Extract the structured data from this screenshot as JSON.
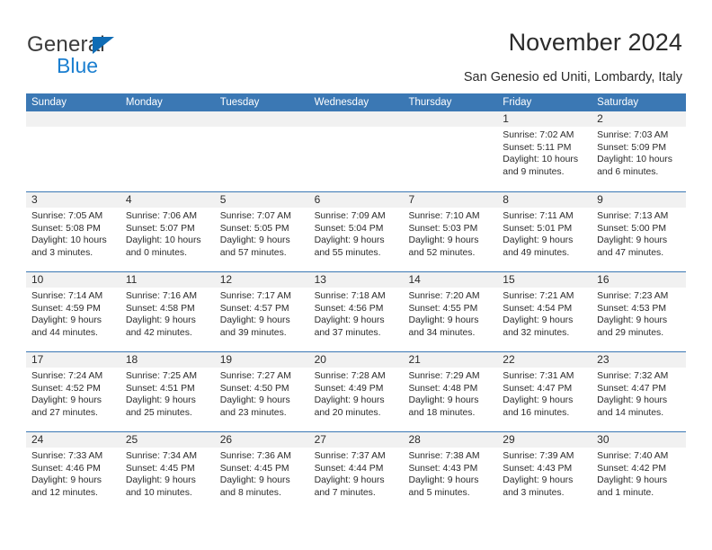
{
  "brand": {
    "name_top": "General",
    "name_bottom": "Blue",
    "accent_color": "#1b7fd0",
    "triangle_color": "#0f6cb5"
  },
  "header": {
    "title": "November 2024",
    "subtitle": "San Genesio ed Uniti, Lombardy, Italy"
  },
  "calendar": {
    "header_bg": "#3b78b4",
    "band_bg": "#f1f1f1",
    "weekday_headers": [
      "Sunday",
      "Monday",
      "Tuesday",
      "Wednesday",
      "Thursday",
      "Friday",
      "Saturday"
    ],
    "weeks": [
      [
        {
          "day": "",
          "lines": []
        },
        {
          "day": "",
          "lines": []
        },
        {
          "day": "",
          "lines": []
        },
        {
          "day": "",
          "lines": []
        },
        {
          "day": "",
          "lines": []
        },
        {
          "day": "1",
          "lines": [
            "Sunrise: 7:02 AM",
            "Sunset: 5:11 PM",
            "Daylight: 10 hours",
            "and 9 minutes."
          ]
        },
        {
          "day": "2",
          "lines": [
            "Sunrise: 7:03 AM",
            "Sunset: 5:09 PM",
            "Daylight: 10 hours",
            "and 6 minutes."
          ]
        }
      ],
      [
        {
          "day": "3",
          "lines": [
            "Sunrise: 7:05 AM",
            "Sunset: 5:08 PM",
            "Daylight: 10 hours",
            "and 3 minutes."
          ]
        },
        {
          "day": "4",
          "lines": [
            "Sunrise: 7:06 AM",
            "Sunset: 5:07 PM",
            "Daylight: 10 hours",
            "and 0 minutes."
          ]
        },
        {
          "day": "5",
          "lines": [
            "Sunrise: 7:07 AM",
            "Sunset: 5:05 PM",
            "Daylight: 9 hours",
            "and 57 minutes."
          ]
        },
        {
          "day": "6",
          "lines": [
            "Sunrise: 7:09 AM",
            "Sunset: 5:04 PM",
            "Daylight: 9 hours",
            "and 55 minutes."
          ]
        },
        {
          "day": "7",
          "lines": [
            "Sunrise: 7:10 AM",
            "Sunset: 5:03 PM",
            "Daylight: 9 hours",
            "and 52 minutes."
          ]
        },
        {
          "day": "8",
          "lines": [
            "Sunrise: 7:11 AM",
            "Sunset: 5:01 PM",
            "Daylight: 9 hours",
            "and 49 minutes."
          ]
        },
        {
          "day": "9",
          "lines": [
            "Sunrise: 7:13 AM",
            "Sunset: 5:00 PM",
            "Daylight: 9 hours",
            "and 47 minutes."
          ]
        }
      ],
      [
        {
          "day": "10",
          "lines": [
            "Sunrise: 7:14 AM",
            "Sunset: 4:59 PM",
            "Daylight: 9 hours",
            "and 44 minutes."
          ]
        },
        {
          "day": "11",
          "lines": [
            "Sunrise: 7:16 AM",
            "Sunset: 4:58 PM",
            "Daylight: 9 hours",
            "and 42 minutes."
          ]
        },
        {
          "day": "12",
          "lines": [
            "Sunrise: 7:17 AM",
            "Sunset: 4:57 PM",
            "Daylight: 9 hours",
            "and 39 minutes."
          ]
        },
        {
          "day": "13",
          "lines": [
            "Sunrise: 7:18 AM",
            "Sunset: 4:56 PM",
            "Daylight: 9 hours",
            "and 37 minutes."
          ]
        },
        {
          "day": "14",
          "lines": [
            "Sunrise: 7:20 AM",
            "Sunset: 4:55 PM",
            "Daylight: 9 hours",
            "and 34 minutes."
          ]
        },
        {
          "day": "15",
          "lines": [
            "Sunrise: 7:21 AM",
            "Sunset: 4:54 PM",
            "Daylight: 9 hours",
            "and 32 minutes."
          ]
        },
        {
          "day": "16",
          "lines": [
            "Sunrise: 7:23 AM",
            "Sunset: 4:53 PM",
            "Daylight: 9 hours",
            "and 29 minutes."
          ]
        }
      ],
      [
        {
          "day": "17",
          "lines": [
            "Sunrise: 7:24 AM",
            "Sunset: 4:52 PM",
            "Daylight: 9 hours",
            "and 27 minutes."
          ]
        },
        {
          "day": "18",
          "lines": [
            "Sunrise: 7:25 AM",
            "Sunset: 4:51 PM",
            "Daylight: 9 hours",
            "and 25 minutes."
          ]
        },
        {
          "day": "19",
          "lines": [
            "Sunrise: 7:27 AM",
            "Sunset: 4:50 PM",
            "Daylight: 9 hours",
            "and 23 minutes."
          ]
        },
        {
          "day": "20",
          "lines": [
            "Sunrise: 7:28 AM",
            "Sunset: 4:49 PM",
            "Daylight: 9 hours",
            "and 20 minutes."
          ]
        },
        {
          "day": "21",
          "lines": [
            "Sunrise: 7:29 AM",
            "Sunset: 4:48 PM",
            "Daylight: 9 hours",
            "and 18 minutes."
          ]
        },
        {
          "day": "22",
          "lines": [
            "Sunrise: 7:31 AM",
            "Sunset: 4:47 PM",
            "Daylight: 9 hours",
            "and 16 minutes."
          ]
        },
        {
          "day": "23",
          "lines": [
            "Sunrise: 7:32 AM",
            "Sunset: 4:47 PM",
            "Daylight: 9 hours",
            "and 14 minutes."
          ]
        }
      ],
      [
        {
          "day": "24",
          "lines": [
            "Sunrise: 7:33 AM",
            "Sunset: 4:46 PM",
            "Daylight: 9 hours",
            "and 12 minutes."
          ]
        },
        {
          "day": "25",
          "lines": [
            "Sunrise: 7:34 AM",
            "Sunset: 4:45 PM",
            "Daylight: 9 hours",
            "and 10 minutes."
          ]
        },
        {
          "day": "26",
          "lines": [
            "Sunrise: 7:36 AM",
            "Sunset: 4:45 PM",
            "Daylight: 9 hours",
            "and 8 minutes."
          ]
        },
        {
          "day": "27",
          "lines": [
            "Sunrise: 7:37 AM",
            "Sunset: 4:44 PM",
            "Daylight: 9 hours",
            "and 7 minutes."
          ]
        },
        {
          "day": "28",
          "lines": [
            "Sunrise: 7:38 AM",
            "Sunset: 4:43 PM",
            "Daylight: 9 hours",
            "and 5 minutes."
          ]
        },
        {
          "day": "29",
          "lines": [
            "Sunrise: 7:39 AM",
            "Sunset: 4:43 PM",
            "Daylight: 9 hours",
            "and 3 minutes."
          ]
        },
        {
          "day": "30",
          "lines": [
            "Sunrise: 7:40 AM",
            "Sunset: 4:42 PM",
            "Daylight: 9 hours",
            "and 1 minute."
          ]
        }
      ]
    ]
  }
}
